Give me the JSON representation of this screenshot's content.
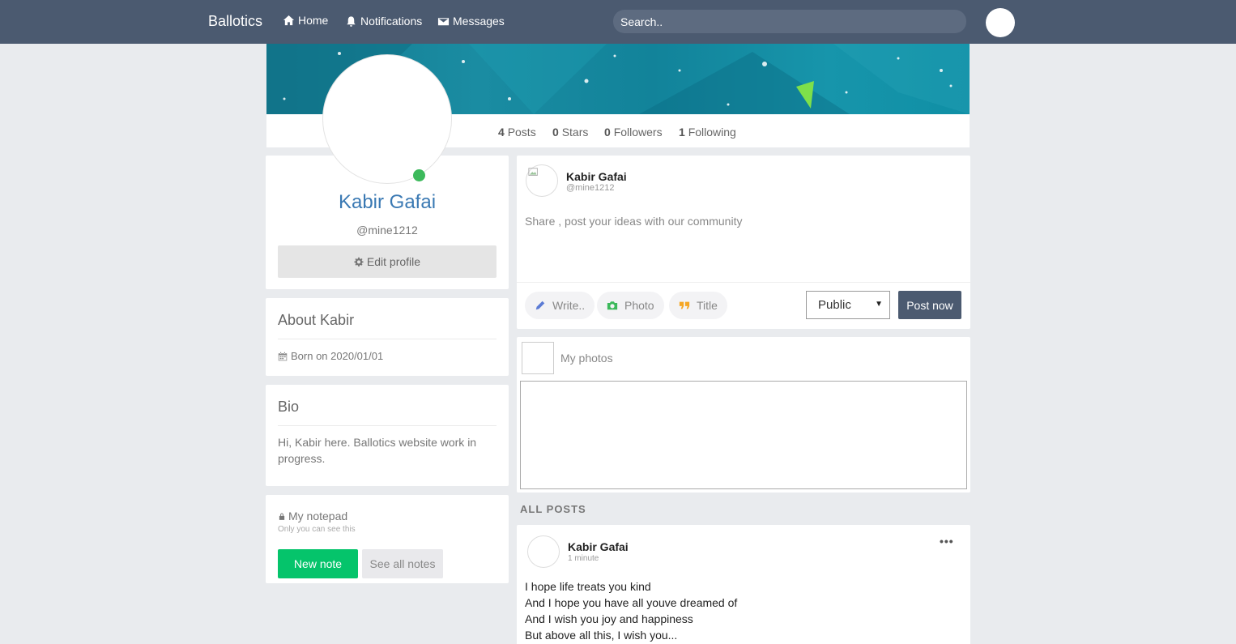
{
  "navbar": {
    "brand": "Ballotics",
    "links": [
      {
        "label": "Home",
        "icon": "home-icon"
      },
      {
        "label": "Notifications",
        "icon": "bell-icon"
      },
      {
        "label": "Messages",
        "icon": "envelope-icon"
      }
    ],
    "search_placeholder": "Search.."
  },
  "stats": {
    "posts_count": "4",
    "posts_label": "Posts",
    "stars_count": "0",
    "stars_label": "Stars",
    "followers_count": "0",
    "followers_label": "Followers",
    "following_count": "1",
    "following_label": "Following"
  },
  "profile": {
    "name": "Kabir Gafai",
    "handle": "@mine1212",
    "edit_label": "Edit profile",
    "online_color": "#3cb95b"
  },
  "about": {
    "title": "About Kabir",
    "born": "Born on 2020/01/01"
  },
  "bio": {
    "title": "Bio",
    "text": "Hi, Kabir here. Ballotics website work in progress."
  },
  "notepad": {
    "title": "My notepad",
    "subtitle": "Only you can see this",
    "new_note": "New note",
    "see_all": "See all notes"
  },
  "composer": {
    "name": "Kabir Gafai",
    "handle": "@mine1212",
    "placeholder": "Share , post your ideas with our community",
    "tools": [
      {
        "label": "Write..",
        "icon": "pencil-icon",
        "color": "#5b7bd5"
      },
      {
        "label": "Photo",
        "icon": "camera-icon",
        "color": "#3cb95b"
      },
      {
        "label": "Title",
        "icon": "quote-icon",
        "color": "#f5a623"
      }
    ],
    "visibility": "Public",
    "post_label": "Post now"
  },
  "photos": {
    "title": "My photos"
  },
  "all_posts": {
    "heading": "ALL POSTS"
  },
  "post": {
    "author": "Kabir Gafai",
    "time": "1 minute",
    "lines": [
      "I hope life treats you kind",
      "And I hope you have all youve dreamed of",
      "And I wish you joy and happiness",
      "But above all this, I wish you..."
    ]
  },
  "colors": {
    "navbar": "#4b5a70",
    "accent_name": "#3a79b3",
    "primary_green": "#05c46b"
  }
}
